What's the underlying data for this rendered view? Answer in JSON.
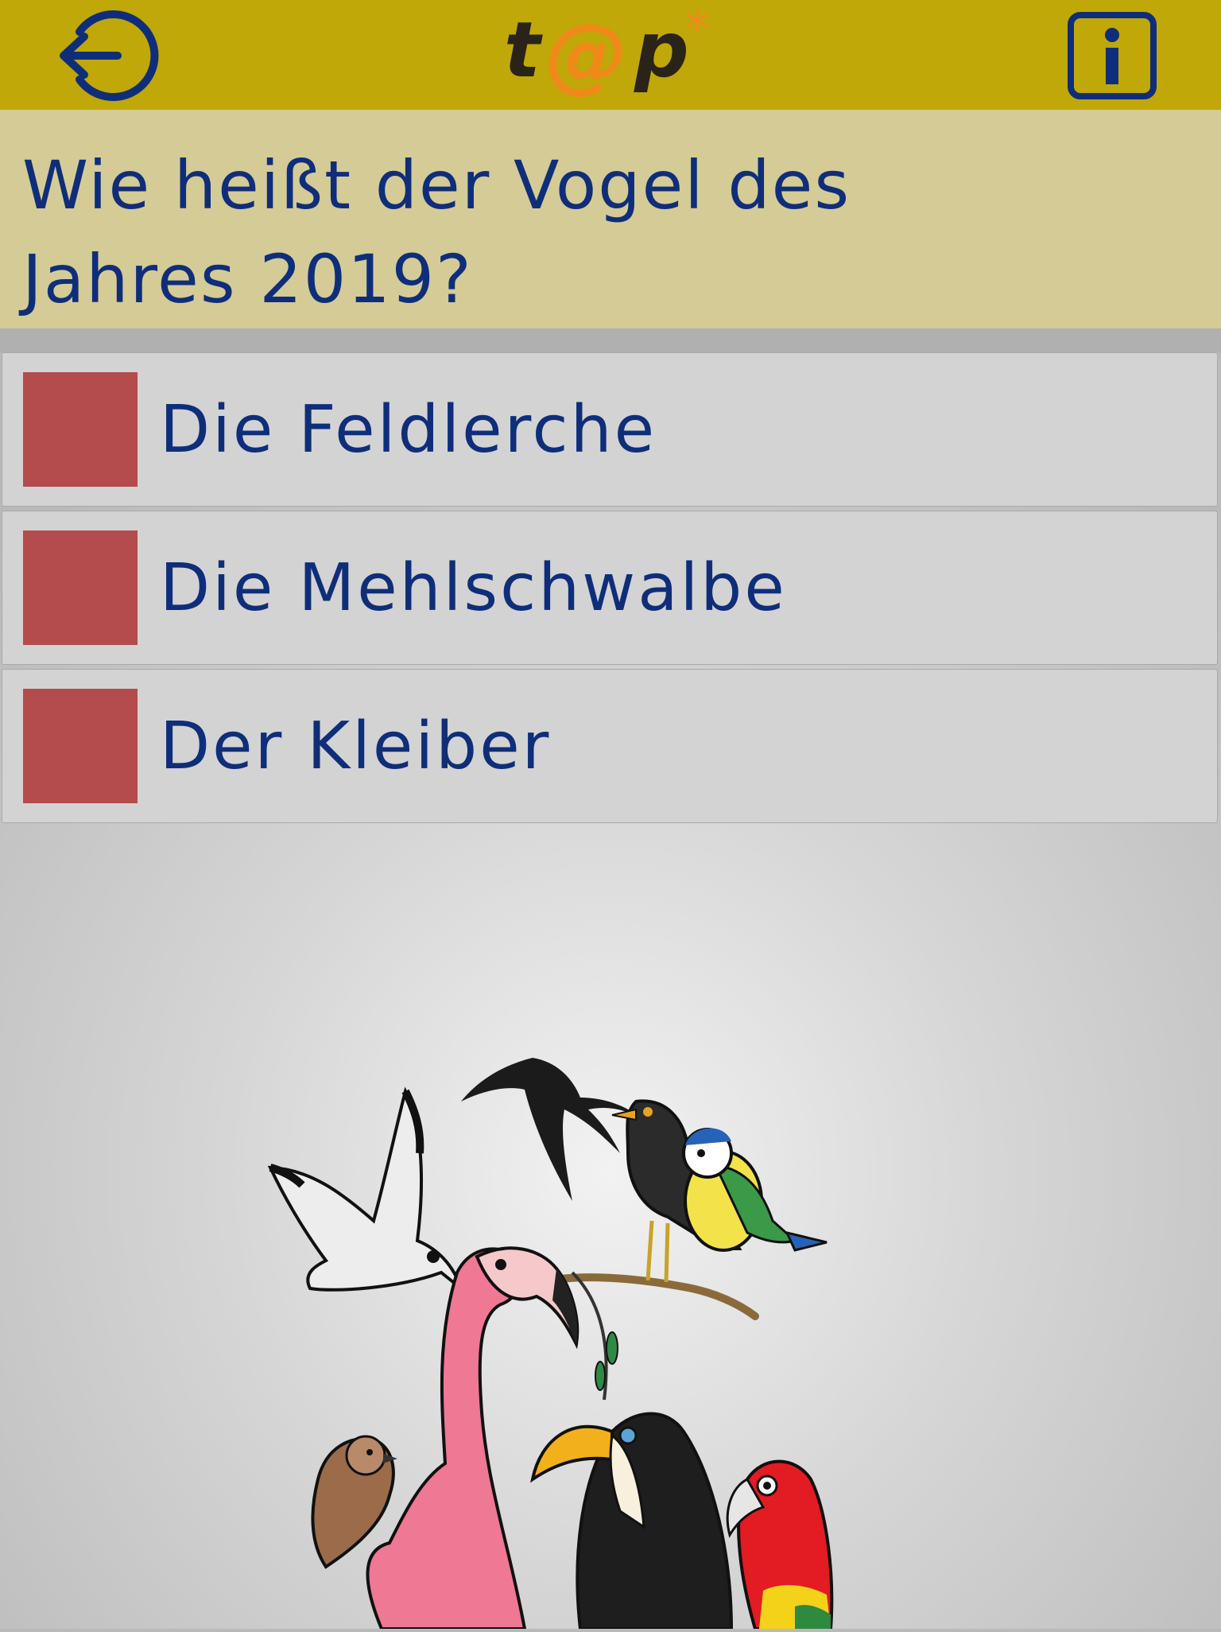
{
  "header": {
    "logo_text": "t@p*",
    "logout_icon": "logout-icon",
    "info_icon": "info-icon",
    "colors": {
      "bar": "#bfa808",
      "icon": "#0f2e7a",
      "logo_dark": "#2a2317",
      "logo_accent": "#ef8a1a"
    }
  },
  "question": {
    "line1": "Wie heißt der Vogel des",
    "line2": "Jahres 2019?"
  },
  "answers": [
    {
      "label": "Die Feldlerche"
    },
    {
      "label": "Die Mehlschwalbe"
    },
    {
      "label": "Der Kleiber"
    }
  ],
  "colors": {
    "question_panel": "#d4cb97",
    "answer_bg": "#d3d3d3",
    "answer_checkbox": "#b44b4d",
    "text": "#0f2e7a"
  },
  "illustration": {
    "icon": "birds-illustration"
  }
}
